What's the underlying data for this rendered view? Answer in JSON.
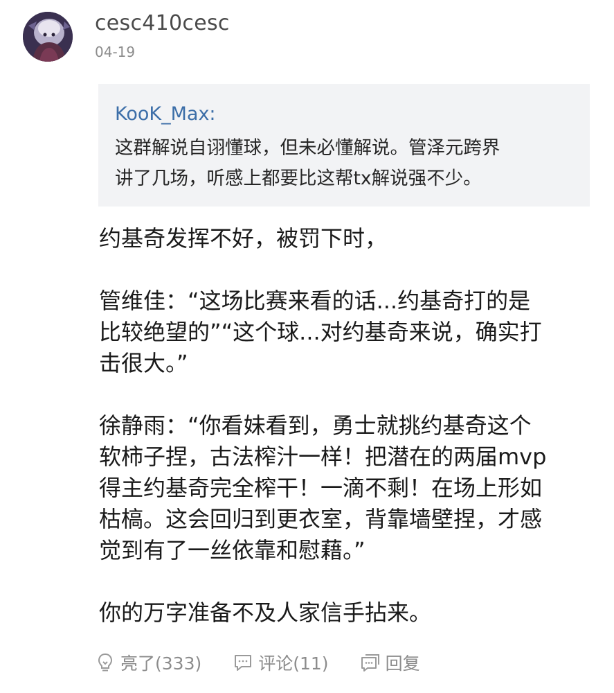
{
  "comment": {
    "username": "cesc410cesc",
    "date": "04-19",
    "quote": {
      "author": "KooK_Max:",
      "lines": [
        "这群解说自诩懂球，但未必懂解说。管泽元跨界",
        "讲了几场，听感上都要比这帮tx解说强不少。"
      ]
    },
    "body_lines": [
      "约基奇发挥不好，被罚下时，",
      "",
      "管维佳：“这场比赛来看的话...约基奇打的是",
      "比较绝望的”“这个球...对约基奇来说，确实打",
      "击很大。”",
      "",
      "徐静雨：“你看妹看到，勇士就挑约基奇这个",
      "软柿子捏，古法榨汁一样！把潜在的两届mvp",
      "得主约基奇完全榨干！一滴不剩！在场上形如",
      "枯槁。这会回归到更衣室，背靠墙壁捏，才感",
      "觉到有了一丝依靠和慰藉。”",
      "",
      "你的万字准备不及人家信手拈来。"
    ],
    "actions": {
      "like_label": "亮了(333)",
      "comment_label": "评论(11)",
      "reply_label": "回复"
    }
  },
  "icons": {
    "like": "lightbulb-icon",
    "comment": "comment-bubble-icon",
    "reply": "reply-bubble-icon"
  },
  "colors": {
    "quote_author": "#3c6ea8",
    "quote_background": "#f2f3f5",
    "meta_gray": "#8c8c8c"
  }
}
